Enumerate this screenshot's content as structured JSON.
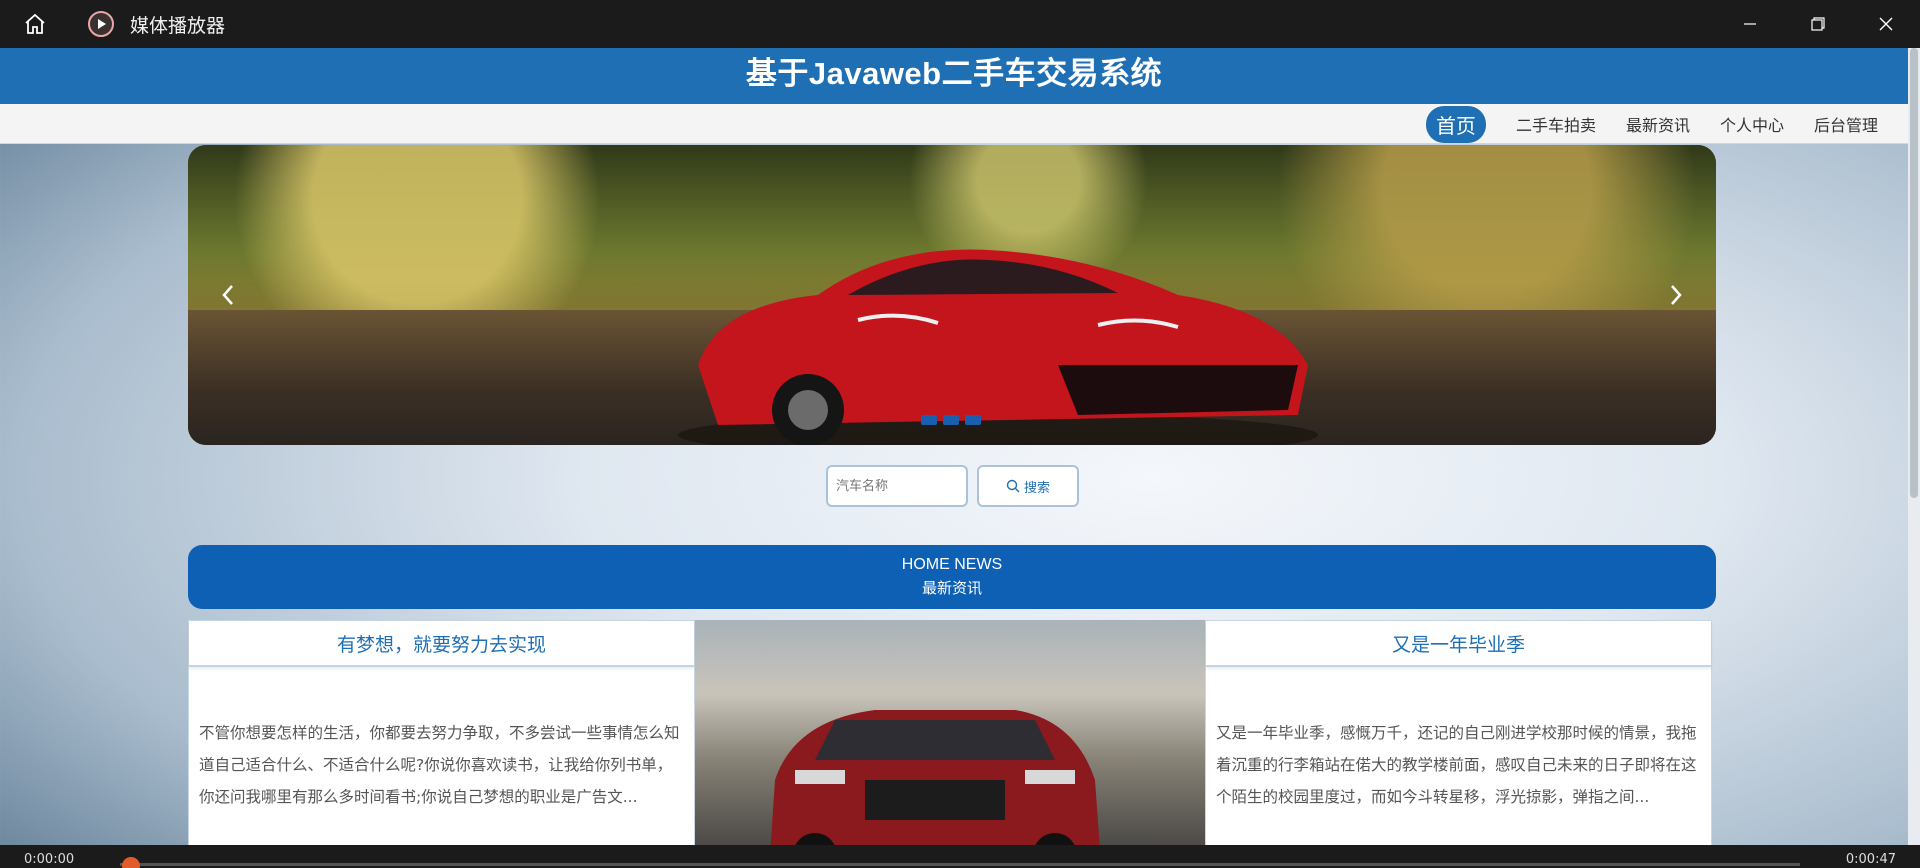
{
  "player": {
    "app_title": "媒体播放器",
    "home_icon": "home-icon",
    "controls": [
      "minimize-icon",
      "restore-icon",
      "close-icon"
    ],
    "time_elapsed": "0:00:00",
    "time_total": "0:00:47"
  },
  "site": {
    "title": "基于Javaweb二手车交易系统"
  },
  "nav": {
    "items": [
      {
        "label": "首页",
        "active": true
      },
      {
        "label": "二手车拍卖",
        "active": false
      },
      {
        "label": "最新资讯",
        "active": false
      },
      {
        "label": "个人中心",
        "active": false
      },
      {
        "label": "后台管理",
        "active": false
      }
    ]
  },
  "carousel": {
    "slide_count": 3,
    "prev_icon": "chevron-left-icon",
    "next_icon": "chevron-right-icon"
  },
  "search": {
    "placeholder": "汽车名称",
    "button_label": "搜索"
  },
  "news_banner": {
    "en": "HOME NEWS",
    "zh": "最新资讯"
  },
  "news": {
    "cards": [
      {
        "title": "有梦想，就要努力去实现",
        "excerpt": "不管你想要怎样的生活，你都要去努力争取，不多尝试一些事情怎么知道自己适合什么、不适合什么呢?你说你喜欢读书，让我给你列书单，你还问我哪里有那么多时间看书;你说自己梦想的职业是广告文..."
      },
      {
        "title": "又是一年毕业季",
        "excerpt": "又是一年毕业季，感慨万千，还记的自己刚进学校那时候的情景，我拖着沉重的行李箱站在偌大的教学楼前面，感叹自己未来的日子即将在这个陌生的校园里度过，而如今斗转星移，浮光掠影，弹指之间..."
      }
    ]
  },
  "colors": {
    "brand_blue": "#1f6fb5",
    "banner_blue": "#0d60b3"
  }
}
